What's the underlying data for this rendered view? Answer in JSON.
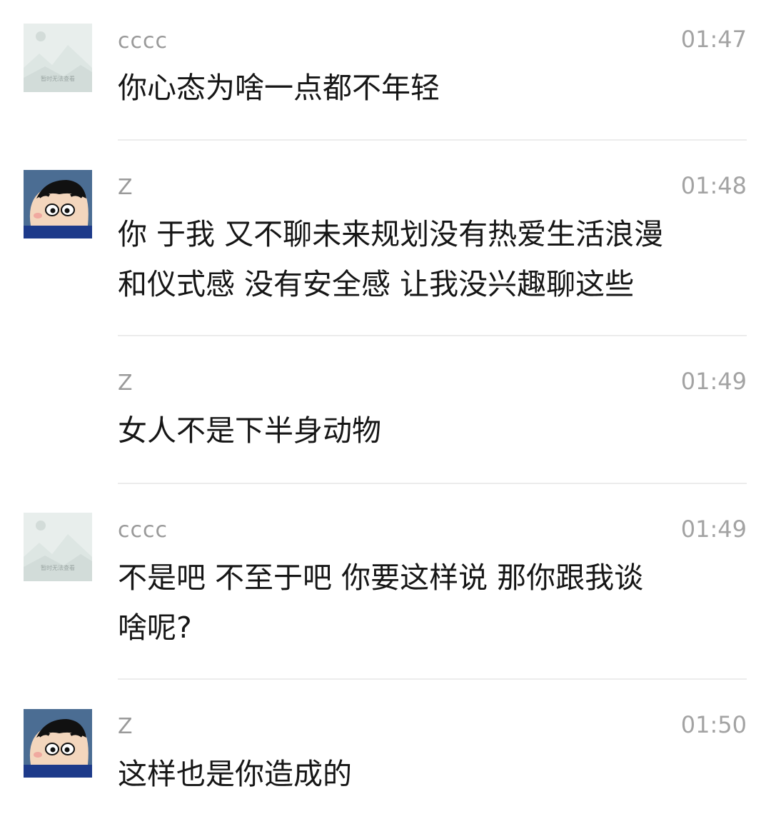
{
  "messages": [
    {
      "sender": "cccc",
      "time": "01:47",
      "text": "你心态为啥一点都不年轻",
      "avatar": "placeholder-image-icon",
      "placeholder_caption": "暂时无法查看"
    },
    {
      "sender": "Z",
      "time": "01:48",
      "text": "你 于我 又不聊未来规划没有热爱生活浪漫\n和仪式感 没有安全感 让我没兴趣聊这些",
      "avatar": "cartoon-boy-avatar"
    },
    {
      "sender": "Z",
      "time": "01:49",
      "text": "女人不是下半身动物",
      "avatar": ""
    },
    {
      "sender": "cccc",
      "time": "01:49",
      "text": "不是吧 不至于吧 你要这样说 那你跟我谈\n啥呢?",
      "avatar": "placeholder-image-icon",
      "placeholder_caption": "暂时无法查看"
    },
    {
      "sender": "Z",
      "time": "01:50",
      "text": "这样也是你造成的",
      "avatar": "cartoon-boy-avatar"
    }
  ]
}
